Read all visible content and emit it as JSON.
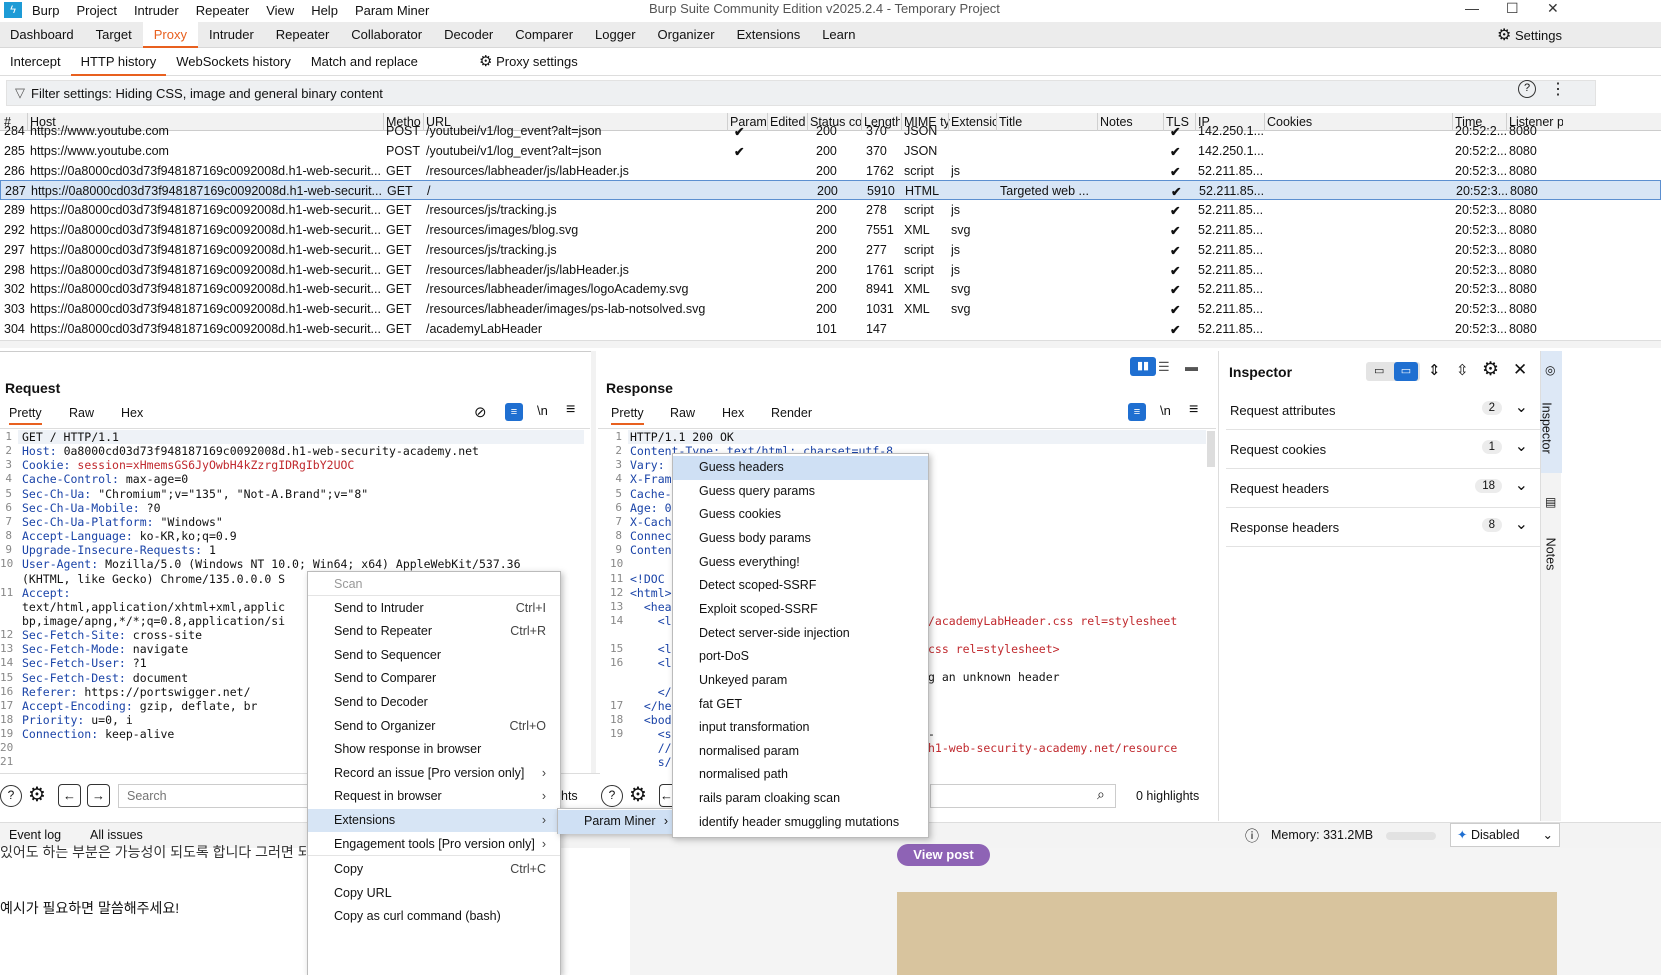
{
  "titlebar": {
    "menu": [
      "Burp",
      "Project",
      "Intruder",
      "Repeater",
      "View",
      "Help",
      "Param Miner"
    ],
    "title": "Burp Suite Community Edition v2025.2.4 - Temporary Project"
  },
  "main_tabs": [
    "Dashboard",
    "Target",
    "Proxy",
    "Intruder",
    "Repeater",
    "Collaborator",
    "Decoder",
    "Comparer",
    "Logger",
    "Organizer",
    "Extensions",
    "Learn"
  ],
  "main_active": "Proxy",
  "settings_label": "Settings",
  "sub_tabs": [
    "Intercept",
    "HTTP history",
    "WebSockets history",
    "Match and replace"
  ],
  "proxy_settings_label": "Proxy settings",
  "filter_text": "Filter settings: Hiding CSS, image and general binary content",
  "table": {
    "columns": [
      "#",
      "Host",
      "Metho",
      "URL",
      "Params",
      "Edited",
      "Status co",
      "Length",
      "MIME ty",
      "Extensic",
      "Title",
      "Notes",
      "TLS",
      "IP",
      "Cookies",
      "Time",
      "Listener p"
    ],
    "rows": [
      {
        "n": "284",
        "host": "https://www.youtube.com",
        "m": "POST",
        "url": "/youtubei/v1/log_event?alt=json",
        "params": "✔",
        "status": "200",
        "len": "370",
        "mime": "JSON",
        "ext": "",
        "title": "",
        "tls": "✔",
        "ip": "142.250.1...",
        "time": "20:52:2...",
        "port": "8080"
      },
      {
        "n": "285",
        "host": "https://www.youtube.com",
        "m": "POST",
        "url": "/youtubei/v1/log_event?alt=json",
        "params": "✔",
        "status": "200",
        "len": "370",
        "mime": "JSON",
        "ext": "",
        "title": "",
        "tls": "✔",
        "ip": "142.250.1...",
        "time": "20:52:2...",
        "port": "8080"
      },
      {
        "n": "286",
        "host": "https://0a8000cd03d73f948187169c0092008d.h1-web-securit...",
        "m": "GET",
        "url": "/resources/labheader/js/labHeader.js",
        "params": "",
        "status": "200",
        "len": "1762",
        "mime": "script",
        "ext": "js",
        "title": "",
        "tls": "✔",
        "ip": "52.211.85....",
        "time": "20:52:3...",
        "port": "8080"
      },
      {
        "n": "287",
        "host": "https://0a8000cd03d73f948187169c0092008d.h1-web-securit...",
        "m": "GET",
        "url": "/",
        "params": "",
        "status": "200",
        "len": "5910",
        "mime": "HTML",
        "ext": "",
        "title": "Targeted web ...",
        "tls": "✔",
        "ip": "52.211.85....",
        "time": "20:52:3...",
        "port": "8080"
      },
      {
        "n": "289",
        "host": "https://0a8000cd03d73f948187169c0092008d.h1-web-securit...",
        "m": "GET",
        "url": "/resources/js/tracking.js",
        "params": "",
        "status": "200",
        "len": "278",
        "mime": "script",
        "ext": "js",
        "title": "",
        "tls": "✔",
        "ip": "52.211.85....",
        "time": "20:52:3...",
        "port": "8080"
      },
      {
        "n": "292",
        "host": "https://0a8000cd03d73f948187169c0092008d.h1-web-securit...",
        "m": "GET",
        "url": "/resources/images/blog.svg",
        "params": "",
        "status": "200",
        "len": "7551",
        "mime": "XML",
        "ext": "svg",
        "title": "",
        "tls": "✔",
        "ip": "52.211.85....",
        "time": "20:52:3...",
        "port": "8080"
      },
      {
        "n": "297",
        "host": "https://0a8000cd03d73f948187169c0092008d.h1-web-securit...",
        "m": "GET",
        "url": "/resources/js/tracking.js",
        "params": "",
        "status": "200",
        "len": "277",
        "mime": "script",
        "ext": "js",
        "title": "",
        "tls": "✔",
        "ip": "52.211.85....",
        "time": "20:52:3...",
        "port": "8080"
      },
      {
        "n": "298",
        "host": "https://0a8000cd03d73f948187169c0092008d.h1-web-securit...",
        "m": "GET",
        "url": "/resources/labheader/js/labHeader.js",
        "params": "",
        "status": "200",
        "len": "1761",
        "mime": "script",
        "ext": "js",
        "title": "",
        "tls": "✔",
        "ip": "52.211.85....",
        "time": "20:52:3...",
        "port": "8080"
      },
      {
        "n": "302",
        "host": "https://0a8000cd03d73f948187169c0092008d.h1-web-securit...",
        "m": "GET",
        "url": "/resources/labheader/images/logoAcademy.svg",
        "params": "",
        "status": "200",
        "len": "8941",
        "mime": "XML",
        "ext": "svg",
        "title": "",
        "tls": "✔",
        "ip": "52.211.85....",
        "time": "20:52:3...",
        "port": "8080"
      },
      {
        "n": "303",
        "host": "https://0a8000cd03d73f948187169c0092008d.h1-web-securit...",
        "m": "GET",
        "url": "/resources/labheader/images/ps-lab-notsolved.svg",
        "params": "",
        "status": "200",
        "len": "1031",
        "mime": "XML",
        "ext": "svg",
        "title": "",
        "tls": "✔",
        "ip": "52.211.85....",
        "time": "20:52:3...",
        "port": "8080"
      },
      {
        "n": "304",
        "host": "https://0a8000cd03d73f948187169c0092008d.h1-web-securit...",
        "m": "GET",
        "url": "/academyLabHeader",
        "params": "",
        "status": "101",
        "len": "147",
        "mime": "",
        "ext": "",
        "title": "",
        "tls": "✔",
        "ip": "52.211.85....",
        "time": "20:52:3...",
        "port": "8080"
      }
    ]
  },
  "request": {
    "title": "Request",
    "tabs": [
      "Pretty",
      "Raw",
      "Hex"
    ],
    "lines": [
      [
        "",
        "GET / HTTP/1.1"
      ],
      [
        "Host:",
        "0a8000cd03d73f948187169c0092008d.h1-web-security-academy.net"
      ],
      [
        "Cookie:",
        "session=xHmemsGS6JyOwbH4kZzrgIDRgIbY2UOC"
      ],
      [
        "Cache-Control:",
        "max-age=0"
      ],
      [
        "Sec-Ch-Ua:",
        "\"Chromium\";v=\"135\", \"Not-A.Brand\";v=\"8\""
      ],
      [
        "Sec-Ch-Ua-Mobile:",
        "?0"
      ],
      [
        "Sec-Ch-Ua-Platform:",
        "\"Windows\""
      ],
      [
        "Accept-Language:",
        "ko-KR,ko;q=0.9"
      ],
      [
        "Upgrade-Insecure-Requests:",
        "1"
      ],
      [
        "User-Agent:",
        "Mozilla/5.0 (Windows NT 10.0; Win64; x64) AppleWebKit/537.36"
      ],
      [
        "",
        "(KHTML, like Gecko) Chrome/135.0.0.0 S"
      ],
      [
        "Accept:",
        ""
      ],
      [
        "",
        "text/html,application/xhtml+xml,applic"
      ],
      [
        "",
        "bp,image/apng,*/*;q=0.8,application/si"
      ],
      [
        "Sec-Fetch-Site:",
        "cross-site"
      ],
      [
        "Sec-Fetch-Mode:",
        "navigate"
      ],
      [
        "Sec-Fetch-User:",
        "?1"
      ],
      [
        "Sec-Fetch-Dest:",
        "document"
      ],
      [
        "Referer:",
        "https://portswigger.net/"
      ],
      [
        "Accept-Encoding:",
        "gzip, deflate, br"
      ],
      [
        "Priority:",
        "u=0, i"
      ],
      [
        "Connection:",
        "keep-alive"
      ]
    ],
    "line_numbers": [
      "1",
      "2",
      "3",
      "4",
      "5",
      "6",
      "7",
      "8",
      "9",
      "10",
      "",
      "11",
      "",
      "",
      "12",
      "13",
      "14",
      "15",
      "16",
      "17",
      "18",
      "19",
      "20",
      "21"
    ],
    "search_placeholder": "Search"
  },
  "response": {
    "title": "Response",
    "tabs": [
      "Pretty",
      "Raw",
      "Hex",
      "Render"
    ],
    "lines": [
      "HTTP/1.1 200 OK",
      "Content-Type: text/html; charset=utf-8",
      "Vary:",
      "X-Fram",
      "Cache-",
      "Age: 0",
      "X-Cach",
      "Connec",
      "Conten",
      "",
      "<!DOC",
      "<html>",
      "  <hea",
      "    <l",
      "",
      "    <l",
      "    <l",
      "",
      "    </",
      "  </he",
      "  <bod",
      "    <s",
      "    //",
      "    s/"
    ],
    "line_numbers": [
      "1",
      "2",
      "3",
      "4",
      "5",
      "6",
      "7",
      "8",
      "9",
      "10",
      "11",
      "12",
      "13",
      "14",
      "",
      "15",
      "16",
      "",
      "",
      "17",
      "18",
      "19",
      "",
      ""
    ],
    "fragments": [
      "/academyLabHeader.css rel=stylesheet",
      "css rel=stylesheet>",
      "g an unknown header",
      "-",
      "h1-web-security-academy.net/resource"
    ],
    "highlights": "0 highlights"
  },
  "context_menu": {
    "items": [
      {
        "label": "Scan",
        "sc": "",
        "dis": true
      },
      {
        "label": "Send to Intruder",
        "sc": "Ctrl+I"
      },
      {
        "label": "Send to Repeater",
        "sc": "Ctrl+R"
      },
      {
        "label": "Send to Sequencer",
        "sc": ""
      },
      {
        "label": "Send to Comparer",
        "sc": ""
      },
      {
        "label": "Send to Decoder",
        "sc": ""
      },
      {
        "label": "Send to Organizer",
        "sc": "Ctrl+O"
      },
      {
        "label": "Show response in browser",
        "sc": ""
      },
      {
        "label": "Record an issue [Pro version only]",
        "sc": "›"
      },
      {
        "label": "Request in browser",
        "sc": "›"
      },
      {
        "label": "Extensions",
        "sc": "›",
        "hl": true
      },
      {
        "label": "Engagement tools [Pro version only]",
        "sc": "›"
      },
      {
        "label": "Copy",
        "sc": "Ctrl+C"
      },
      {
        "label": "Copy URL",
        "sc": ""
      },
      {
        "label": "Copy as curl command (bash)",
        "sc": ""
      }
    ]
  },
  "extensions_menu": {
    "item": "Param Miner",
    "arrow": "›"
  },
  "param_miner_menu": [
    "Guess headers",
    "Guess query params",
    "Guess cookies",
    "Guess body params",
    "Guess everything!",
    "Detect scoped-SSRF",
    "Exploit scoped-SSRF",
    "Detect server-side injection",
    "port-DoS",
    "Unkeyed param",
    "fat GET",
    "input transformation",
    "normalised param",
    "normalised path",
    "rails param cloaking scan",
    "identify header smuggling mutations"
  ],
  "inspector": {
    "title": "Inspector",
    "rows": [
      {
        "label": "Request attributes",
        "count": "2"
      },
      {
        "label": "Request cookies",
        "count": "1"
      },
      {
        "label": "Request headers",
        "count": "18"
      },
      {
        "label": "Response headers",
        "count": "8"
      }
    ],
    "side_tabs": [
      "Inspector",
      "Notes"
    ]
  },
  "status_bar": {
    "tabs": [
      "Event log",
      "All issues"
    ],
    "memory": "Memory: 331.2MB",
    "disabled": "Disabled"
  },
  "background": {
    "view_post": "View post",
    "korean1": "있어도 하는 부분은 가능성이 되도록 합니다 그러면 되는",
    "korean2": "예시가 필요하면 말씀해주세요!"
  },
  "colors": {
    "accent": "#e8601f",
    "selected_row": "#d7e5f5",
    "header_key": "#1b44a8",
    "header_value": "#c0292e"
  }
}
